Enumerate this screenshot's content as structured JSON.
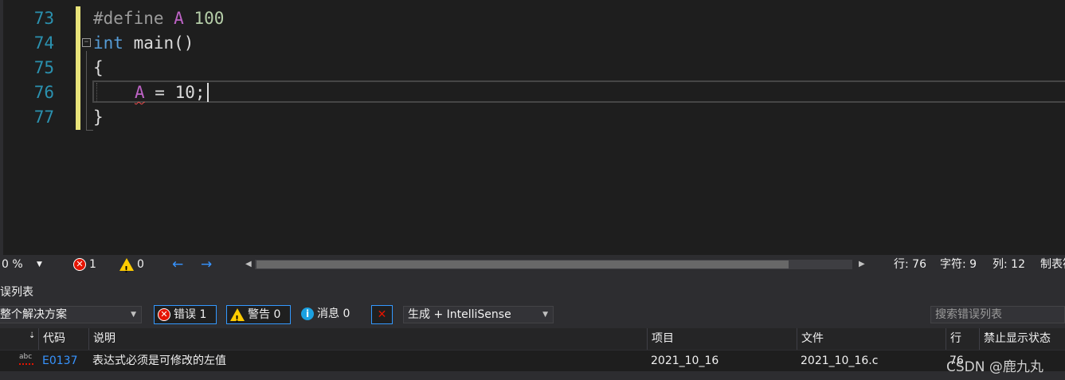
{
  "editor": {
    "lines": [
      {
        "num": "73"
      },
      {
        "num": "74"
      },
      {
        "num": "75"
      },
      {
        "num": "76"
      },
      {
        "num": "77"
      }
    ],
    "tokens": {
      "l73_define": "#define",
      "l73_macro": "A",
      "l73_value": "100",
      "l74_type": "int",
      "l74_name": " main()",
      "l75_brace": "{",
      "l76_var": "A",
      "l76_rest": " = 10;",
      "l77_brace": "}"
    },
    "fold_icon": "−"
  },
  "statusbar": {
    "zoom": "0 %",
    "errors": "1",
    "warnings": "0",
    "line": "行: 76",
    "char": "字符: 9",
    "col": "列: 12",
    "tab": "制表符"
  },
  "error_list": {
    "title": "误列表",
    "scope": "整个解决方案",
    "errors_btn": "错误 1",
    "warnings_btn": "警告 0",
    "messages_btn": "消息 0",
    "source": "生成 + IntelliSense",
    "search_placeholder": "搜索错误列表",
    "columns": {
      "code": "代码",
      "desc": "说明",
      "project": "项目",
      "file": "文件",
      "line": "行",
      "suppress": "禁止显示状态"
    },
    "rows": [
      {
        "code": "E0137",
        "desc": "表达式必须是可修改的左值",
        "project": "2021_10_16",
        "file": "2021_10_16.c",
        "line": "76"
      }
    ]
  },
  "watermark": "CSDN @鹿九丸",
  "colors": {
    "accent": "#3794ff",
    "error": "#e51400",
    "warning": "#ffcc00",
    "change_bar": "#e8e37a"
  }
}
